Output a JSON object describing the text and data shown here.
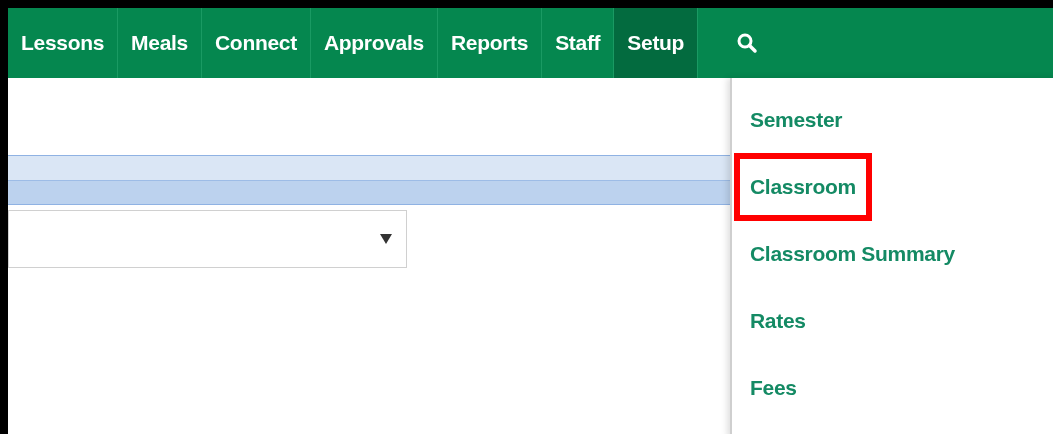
{
  "nav": {
    "items": [
      {
        "label": "Lessons",
        "selected": false
      },
      {
        "label": "Meals",
        "selected": false
      },
      {
        "label": "Connect",
        "selected": false
      },
      {
        "label": "Approvals",
        "selected": false
      },
      {
        "label": "Reports",
        "selected": false
      },
      {
        "label": "Staff",
        "selected": false
      },
      {
        "label": "Setup",
        "selected": true
      }
    ]
  },
  "setup_menu": {
    "items": [
      {
        "label": "Semester",
        "highlighted": false
      },
      {
        "label": "Classroom",
        "highlighted": true
      },
      {
        "label": "Classroom Summary",
        "highlighted": false
      },
      {
        "label": "Rates",
        "highlighted": false
      },
      {
        "label": "Fees",
        "highlighted": false
      }
    ]
  }
}
